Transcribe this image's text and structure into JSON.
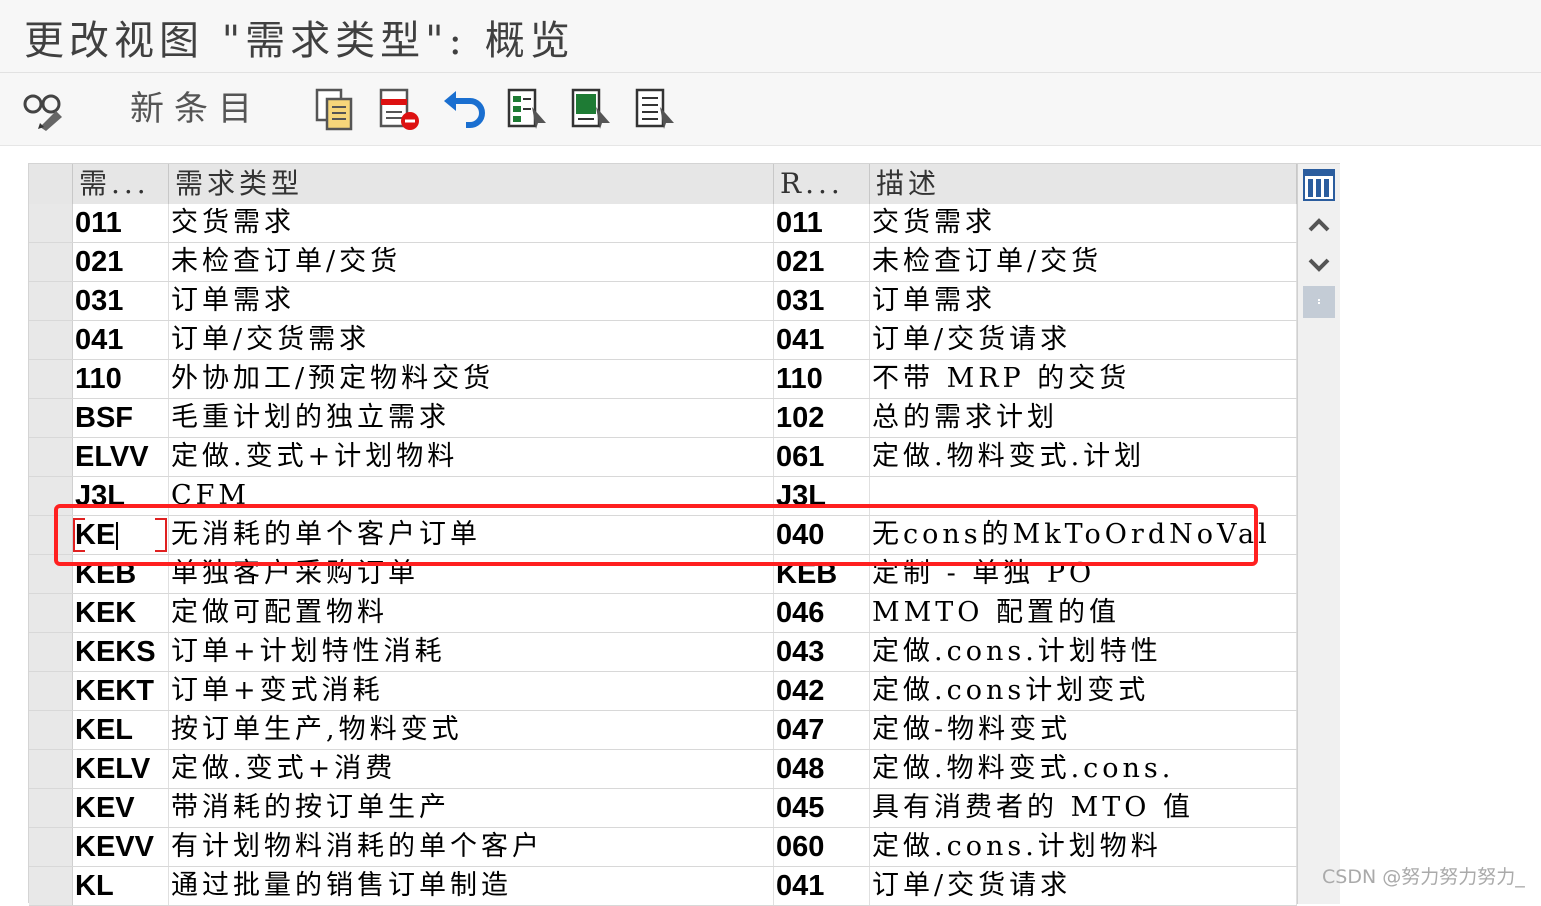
{
  "window": {
    "title": "更改视图 \"需求类型\": 概览"
  },
  "toolbar": {
    "new_entries_label": "新条目",
    "icons": [
      "display-change-icon",
      "copy-icon",
      "delete-icon",
      "undo-icon",
      "select-all-icon",
      "select-block-icon",
      "deselect-all-icon"
    ]
  },
  "table": {
    "headers": [
      "需...",
      "需求类型",
      "R...",
      "描述"
    ],
    "rows": [
      [
        "011",
        "交货需求",
        "011",
        "交货需求"
      ],
      [
        "021",
        "未检查订单/交货",
        "021",
        "未检查订单/交货"
      ],
      [
        "031",
        "订单需求",
        "031",
        "订单需求"
      ],
      [
        "041",
        "订单/交货需求",
        "041",
        "订单/交货请求"
      ],
      [
        "110",
        "外协加工/预定物料交货",
        "110",
        "不带 MRP 的交货"
      ],
      [
        "BSF",
        "毛重计划的独立需求",
        "102",
        "总的需求计划"
      ],
      [
        "ELVV",
        "定做.变式+计划物料",
        "061",
        "定做.物料变式.计划"
      ],
      [
        "J3L",
        "CFM",
        "J3L",
        ""
      ],
      [
        "KE",
        "无消耗的单个客户订单",
        "040",
        "无cons的MkToOrdNoVal"
      ],
      [
        "KEB",
        "单独客户采购订单",
        "KEB",
        "定制 - 单独 PO"
      ],
      [
        "KEK",
        "定做可配置物料",
        "046",
        "MMTO 配置的值"
      ],
      [
        "KEKS",
        "订单+计划特性消耗",
        "043",
        "定做.cons.计划特性"
      ],
      [
        "KEKT",
        "订单+变式消耗",
        "042",
        "定做.cons计划变式"
      ],
      [
        "KEL",
        "按订单生产,物料变式",
        "047",
        "定做-物料变式"
      ],
      [
        "KELV",
        "定做.变式+消费",
        "048",
        "定做.物料变式.cons."
      ],
      [
        "KEV",
        "带消耗的按订单生产",
        "045",
        "具有消费者的 MTO 值"
      ],
      [
        "KEVV",
        "有计划物料消耗的单个客户",
        "060",
        "定做.cons.计划物料"
      ],
      [
        "KL",
        "通过批量的销售订单制造",
        "041",
        "订单/交货请求"
      ]
    ]
  },
  "colors": {
    "highlight": "#ff2020",
    "accent_blue": "#1a6fd0",
    "toolbar_green": "#1e7b34"
  },
  "watermark": "CSDN @努力努力努力_"
}
